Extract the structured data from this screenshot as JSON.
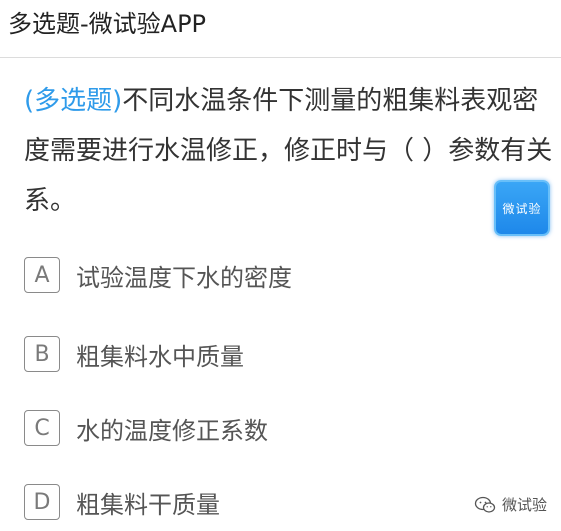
{
  "header": {
    "title": "多选题-微试验APP"
  },
  "question": {
    "type_tag": "(多选题)",
    "text": "不同水温条件下测量的粗集料表观密度需要进行水温修正，修正时与（ ）参数有关系。"
  },
  "badge": {
    "label": "微试验"
  },
  "options": [
    {
      "letter": "A",
      "text": "试验温度下水的密度"
    },
    {
      "letter": "B",
      "text": "粗集料水中质量"
    },
    {
      "letter": "C",
      "text": "水的温度修正系数"
    },
    {
      "letter": "D",
      "text": "粗集料干质量"
    }
  ],
  "watermark": {
    "text": "微试验",
    "icon": "wechat-icon"
  },
  "colors": {
    "accent": "#2f9bea",
    "badge": "#1e88ea",
    "text": "#333333",
    "border": "#8a8a8a"
  }
}
